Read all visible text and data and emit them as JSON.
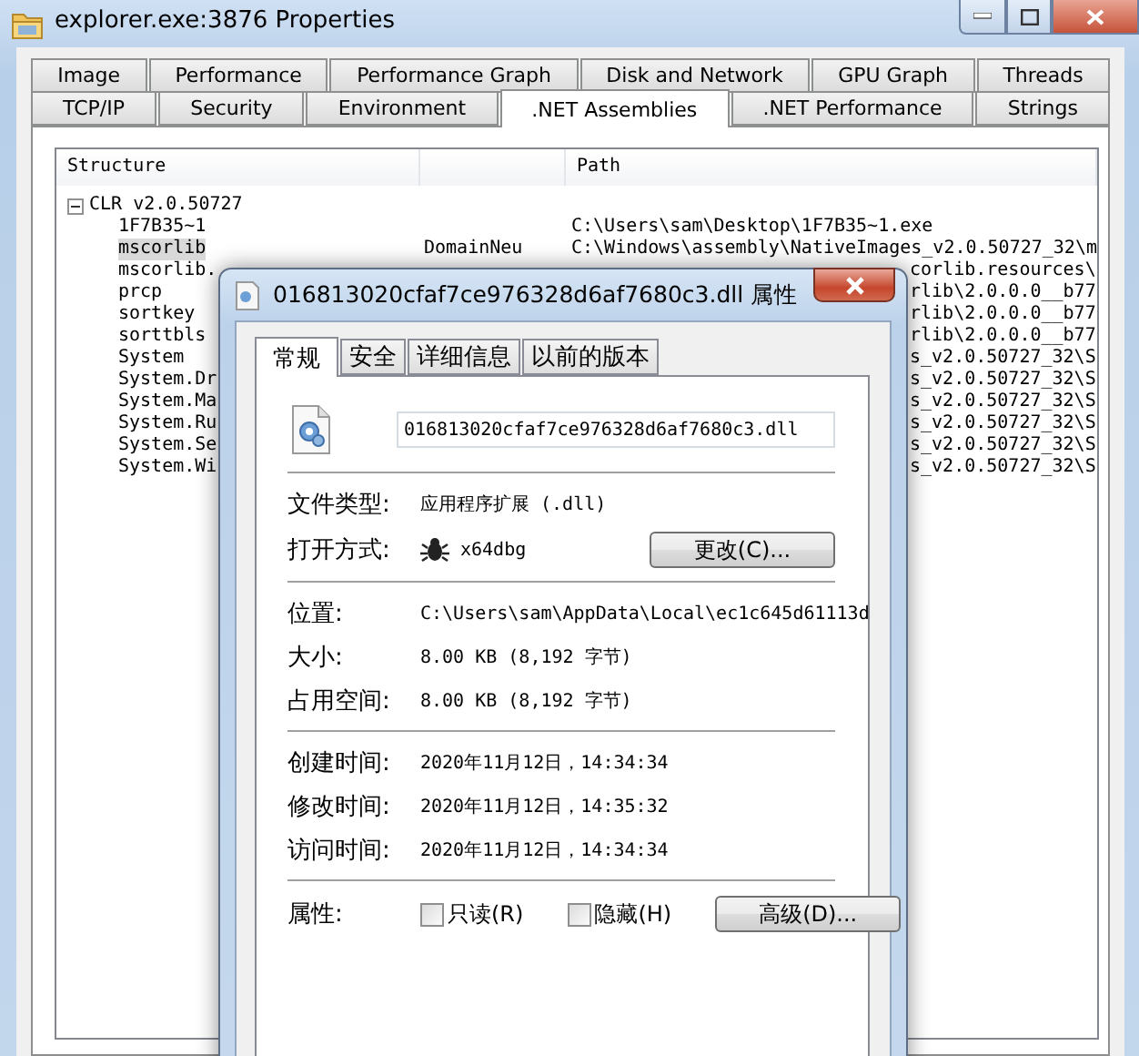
{
  "window": {
    "title": "explorer.exe:3876 Properties",
    "tab_rows": [
      {
        "tabs": [
          {
            "label": "Image",
            "selected": false
          },
          {
            "label": "Performance",
            "selected": false
          },
          {
            "label": "Performance Graph",
            "selected": false
          },
          {
            "label": "Disk and Network",
            "selected": false
          },
          {
            "label": "GPU Graph",
            "selected": false
          },
          {
            "label": "Threads",
            "selected": false
          }
        ]
      },
      {
        "tabs": [
          {
            "label": "TCP/IP",
            "selected": false
          },
          {
            "label": "Security",
            "selected": false
          },
          {
            "label": "Environment",
            "selected": false
          },
          {
            "label": ".NET Assemblies",
            "selected": true
          },
          {
            "label": ".NET Performance",
            "selected": false
          },
          {
            "label": "Strings",
            "selected": false
          }
        ]
      }
    ]
  },
  "assemblies": {
    "columns": [
      {
        "label": "Structure"
      },
      {
        "label": "Path"
      }
    ],
    "tree": [
      {
        "label": "CLR v2.0.50727",
        "expanded": true,
        "children": [
          {
            "label": "1F7B35~1",
            "selected": false,
            "path": "C:\\Users\\sam\\Desktop\\1F7B35~1.exe",
            "covered": false
          },
          {
            "label": "mscorlib",
            "selected": true,
            "column_2": "DomainNeu",
            "path": "C:\\Windows\\assembly\\NativeImages_v2.0.50727_32\\m",
            "covered": false
          },
          {
            "label": "mscorlib.",
            "selected": false,
            "path": "corlib.resources\\",
            "covered": true
          },
          {
            "label": "prcp",
            "selected": false,
            "path": "rlib\\2.0.0.0__b77",
            "covered": true
          },
          {
            "label": "sortkey",
            "selected": false,
            "path": "rlib\\2.0.0.0__b77",
            "covered": true
          },
          {
            "label": "sorttbls",
            "selected": false,
            "path": "rlib\\2.0.0.0__b77",
            "covered": true
          },
          {
            "label": "System",
            "selected": false,
            "path": "s_v2.0.50727_32\\S",
            "covered": true
          },
          {
            "label": "System.Dr",
            "selected": false,
            "path": "s_v2.0.50727_32\\S",
            "covered": true
          },
          {
            "label": "System.Ma",
            "selected": false,
            "path": "s_v2.0.50727_32\\S",
            "covered": true
          },
          {
            "label": "System.Ru",
            "selected": false,
            "path": "s_v2.0.50727_32\\S",
            "covered": true
          },
          {
            "label": "System.Se",
            "selected": false,
            "path": "s_v2.0.50727_32\\S",
            "covered": true
          },
          {
            "label": "System.Wi",
            "selected": false,
            "path": "s_v2.0.50727_32\\S",
            "covered": true
          }
        ]
      }
    ]
  },
  "dialog": {
    "title": "016813020cfaf7ce976328d6af7680c3.dll 属性",
    "tabs": [
      {
        "label": "常规",
        "selected": true
      },
      {
        "label": "安全",
        "selected": false
      },
      {
        "label": "详细信息",
        "selected": false
      },
      {
        "label": "以前的版本",
        "selected": false
      }
    ],
    "file_name": "016813020cfaf7ce976328d6af7680c3.dll",
    "sections": [
      {
        "rows": [
          {
            "kind": "text",
            "label": "文件类型:",
            "value": "应用程序扩展 (.dll)"
          },
          {
            "kind": "app",
            "label": "打开方式:",
            "value": "x64dbg",
            "button": "更改(C)..."
          }
        ]
      },
      {
        "rows": [
          {
            "kind": "text",
            "label": "位置:",
            "value": "C:\\Users\\sam\\AppData\\Local\\ec1c645d61113d"
          },
          {
            "kind": "text",
            "label": "大小:",
            "value": "8.00 KB (8,192 字节)"
          },
          {
            "kind": "text",
            "label": "占用空间:",
            "value": "8.00 KB (8,192 字节)"
          }
        ]
      },
      {
        "rows": [
          {
            "kind": "text",
            "label": "创建时间:",
            "value": "2020年11月12日，14:34:34"
          },
          {
            "kind": "text",
            "label": "修改时间:",
            "value": "2020年11月12日，14:35:32"
          },
          {
            "kind": "text",
            "label": "访问时间:",
            "value": "2020年11月12日，14:34:34"
          }
        ]
      },
      {
        "rows": [
          {
            "kind": "attributes",
            "label": "属性:",
            "checkboxes": [
              {
                "label": "只读(R)",
                "checked": false
              },
              {
                "label": "隐藏(H)",
                "checked": false
              }
            ],
            "button": "高级(D)..."
          }
        ]
      }
    ]
  }
}
